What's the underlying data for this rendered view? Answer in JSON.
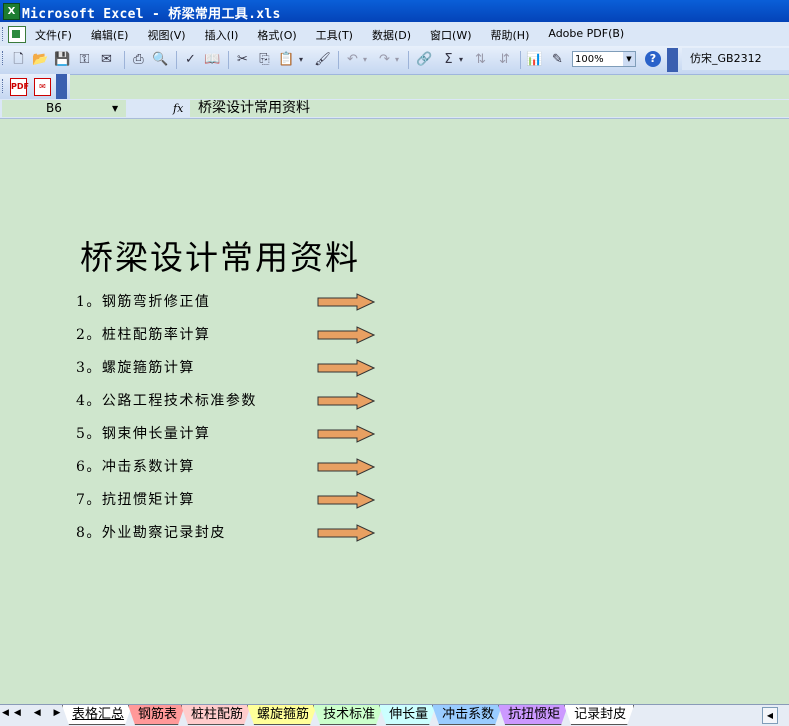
{
  "window": {
    "title": "Microsoft Excel - 桥梁常用工具.xls",
    "app_icon_letter": "X"
  },
  "menu": {
    "items": [
      "文件(F)",
      "编辑(E)",
      "视图(V)",
      "插入(I)",
      "格式(O)",
      "工具(T)",
      "数据(D)",
      "窗口(W)",
      "帮助(H)",
      "Adobe PDF(B)"
    ]
  },
  "toolbar": {
    "zoom": "100%",
    "font_name": "仿宋_GB2312",
    "help": "?"
  },
  "formula_bar": {
    "cell_ref": "B6",
    "fx_label": "fx",
    "formula_value": "桥梁设计常用资料"
  },
  "sheet": {
    "title": "桥梁设计常用资料",
    "items": [
      "1。钢筋弯折修正值",
      "2。桩柱配筋率计算",
      "3。螺旋箍筋计算",
      "4。公路工程技术标准参数",
      "5。钢束伸长量计算",
      "6。冲击系数计算",
      "7。抗扭惯矩计算",
      "8。外业勘察记录封皮"
    ],
    "arrow_color": "#e8a062"
  },
  "tabs": {
    "nav": "◀◀ ◀ ▶ ▶▶",
    "items": [
      {
        "label": "表格汇总",
        "color": "#ffffff"
      },
      {
        "label": "钢筋表",
        "color": "#ff9999"
      },
      {
        "label": "桩柱配筋",
        "color": "#ffcccc"
      },
      {
        "label": "螺旋箍筋",
        "color": "#ffff99"
      },
      {
        "label": "技术标准",
        "color": "#ccffcc"
      },
      {
        "label": "伸长量",
        "color": "#ccffff"
      },
      {
        "label": "冲击系数",
        "color": "#99ccff"
      },
      {
        "label": "抗扭惯矩",
        "color": "#cc99ff"
      },
      {
        "label": "记录封皮",
        "color": "#ffffff"
      }
    ]
  }
}
